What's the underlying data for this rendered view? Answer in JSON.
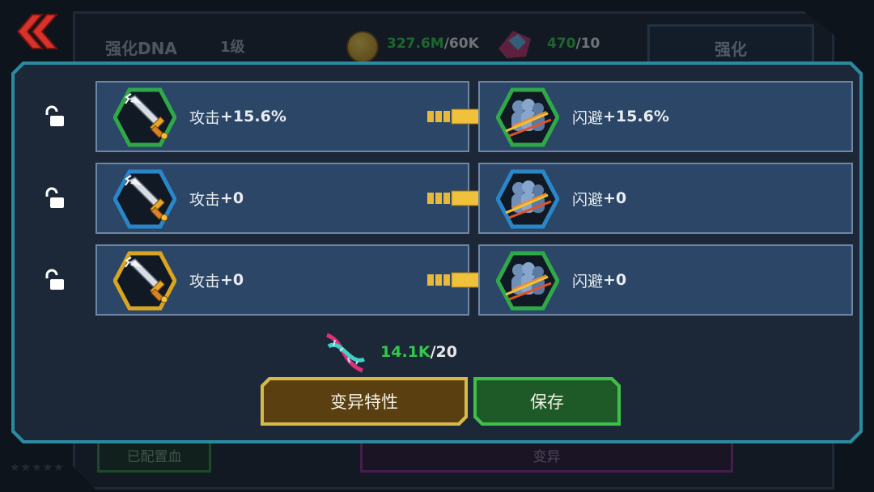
{
  "background": {
    "dna_label": "强化DNA",
    "level": "1级",
    "gold_have": "327.6M",
    "gold_need": "/60K",
    "gems_have": "470",
    "gems_need": "/10",
    "upgrade_button": "强化",
    "bottom_left_button": "已配置血",
    "bottom_right_button": "变异"
  },
  "traits": [
    {
      "left": {
        "name": "攻击",
        "value": "+15.6%",
        "icon": "sword-icon",
        "frame_color": "#2fa84a"
      },
      "right": {
        "name": "闪避",
        "value": "+15.6%",
        "icon": "dodge-icon",
        "frame_color": "#2fa84a"
      }
    },
    {
      "left": {
        "name": "攻击",
        "value": "+0",
        "icon": "sword-icon",
        "frame_color": "#2a86c9"
      },
      "right": {
        "name": "闪避",
        "value": "+0",
        "icon": "dodge-icon",
        "frame_color": "#2a86c9"
      }
    },
    {
      "left": {
        "name": "攻击",
        "value": "+0",
        "icon": "sword-icon",
        "frame_color": "#d9a520"
      },
      "right": {
        "name": "闪避",
        "value": "+0",
        "icon": "dodge-icon",
        "frame_color": "#2fa84a"
      }
    }
  ],
  "mutation_cost": {
    "have": "14.1K",
    "need": "/20"
  },
  "buttons": {
    "mutate": "变异特性",
    "save": "保存"
  },
  "colors": {
    "accent_green": "#32c94a",
    "modal_border": "#2a8ba0",
    "panel_bg": "#2b4666"
  }
}
